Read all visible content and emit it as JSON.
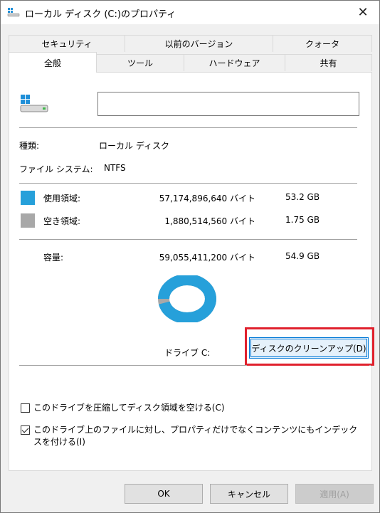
{
  "window": {
    "title": "ローカル ディスク (C:)のプロパティ",
    "close_label": "✕"
  },
  "tabs": {
    "row1": [
      "セキュリティ",
      "以前のバージョン",
      "クォータ"
    ],
    "row2": [
      "全般",
      "ツール",
      "ハードウェア",
      "共有"
    ],
    "active": "全般"
  },
  "general": {
    "volume_name_value": "",
    "type_label": "種類:",
    "type_value": "ローカル ディスク",
    "fs_label": "ファイル システム:",
    "fs_value": "NTFS",
    "used": {
      "label": "使用領域:",
      "bytes": "57,174,896,640 バイト",
      "size": "53.2 GB",
      "color": "#26a0da"
    },
    "free": {
      "label": "空き領域:",
      "bytes": "1,880,514,560 バイト",
      "size": "1.75 GB",
      "color": "#a8a8a8"
    },
    "capacity": {
      "label": "容量:",
      "bytes": "59,055,411,200 バイト",
      "size": "54.9 GB"
    },
    "used_fraction": 0.968,
    "drive_label": "ドライブ C:",
    "cleanup_button": "ディスクのクリーンアップ(D)"
  },
  "options": {
    "compress": {
      "label": "このドライブを圧縮してディスク領域を空ける(C)",
      "checked": false
    },
    "index": {
      "label_line1": "このドライブ上のファイルに対し、プロパティだけでなくコンテンツにもインデック",
      "label_line2": "スを付ける(I)",
      "checked": true
    }
  },
  "buttons": {
    "ok": "OK",
    "cancel": "キャンセル",
    "apply": "適用(A)"
  },
  "icons": {
    "title": "drive-icon",
    "drive": "windows-drive-icon"
  }
}
